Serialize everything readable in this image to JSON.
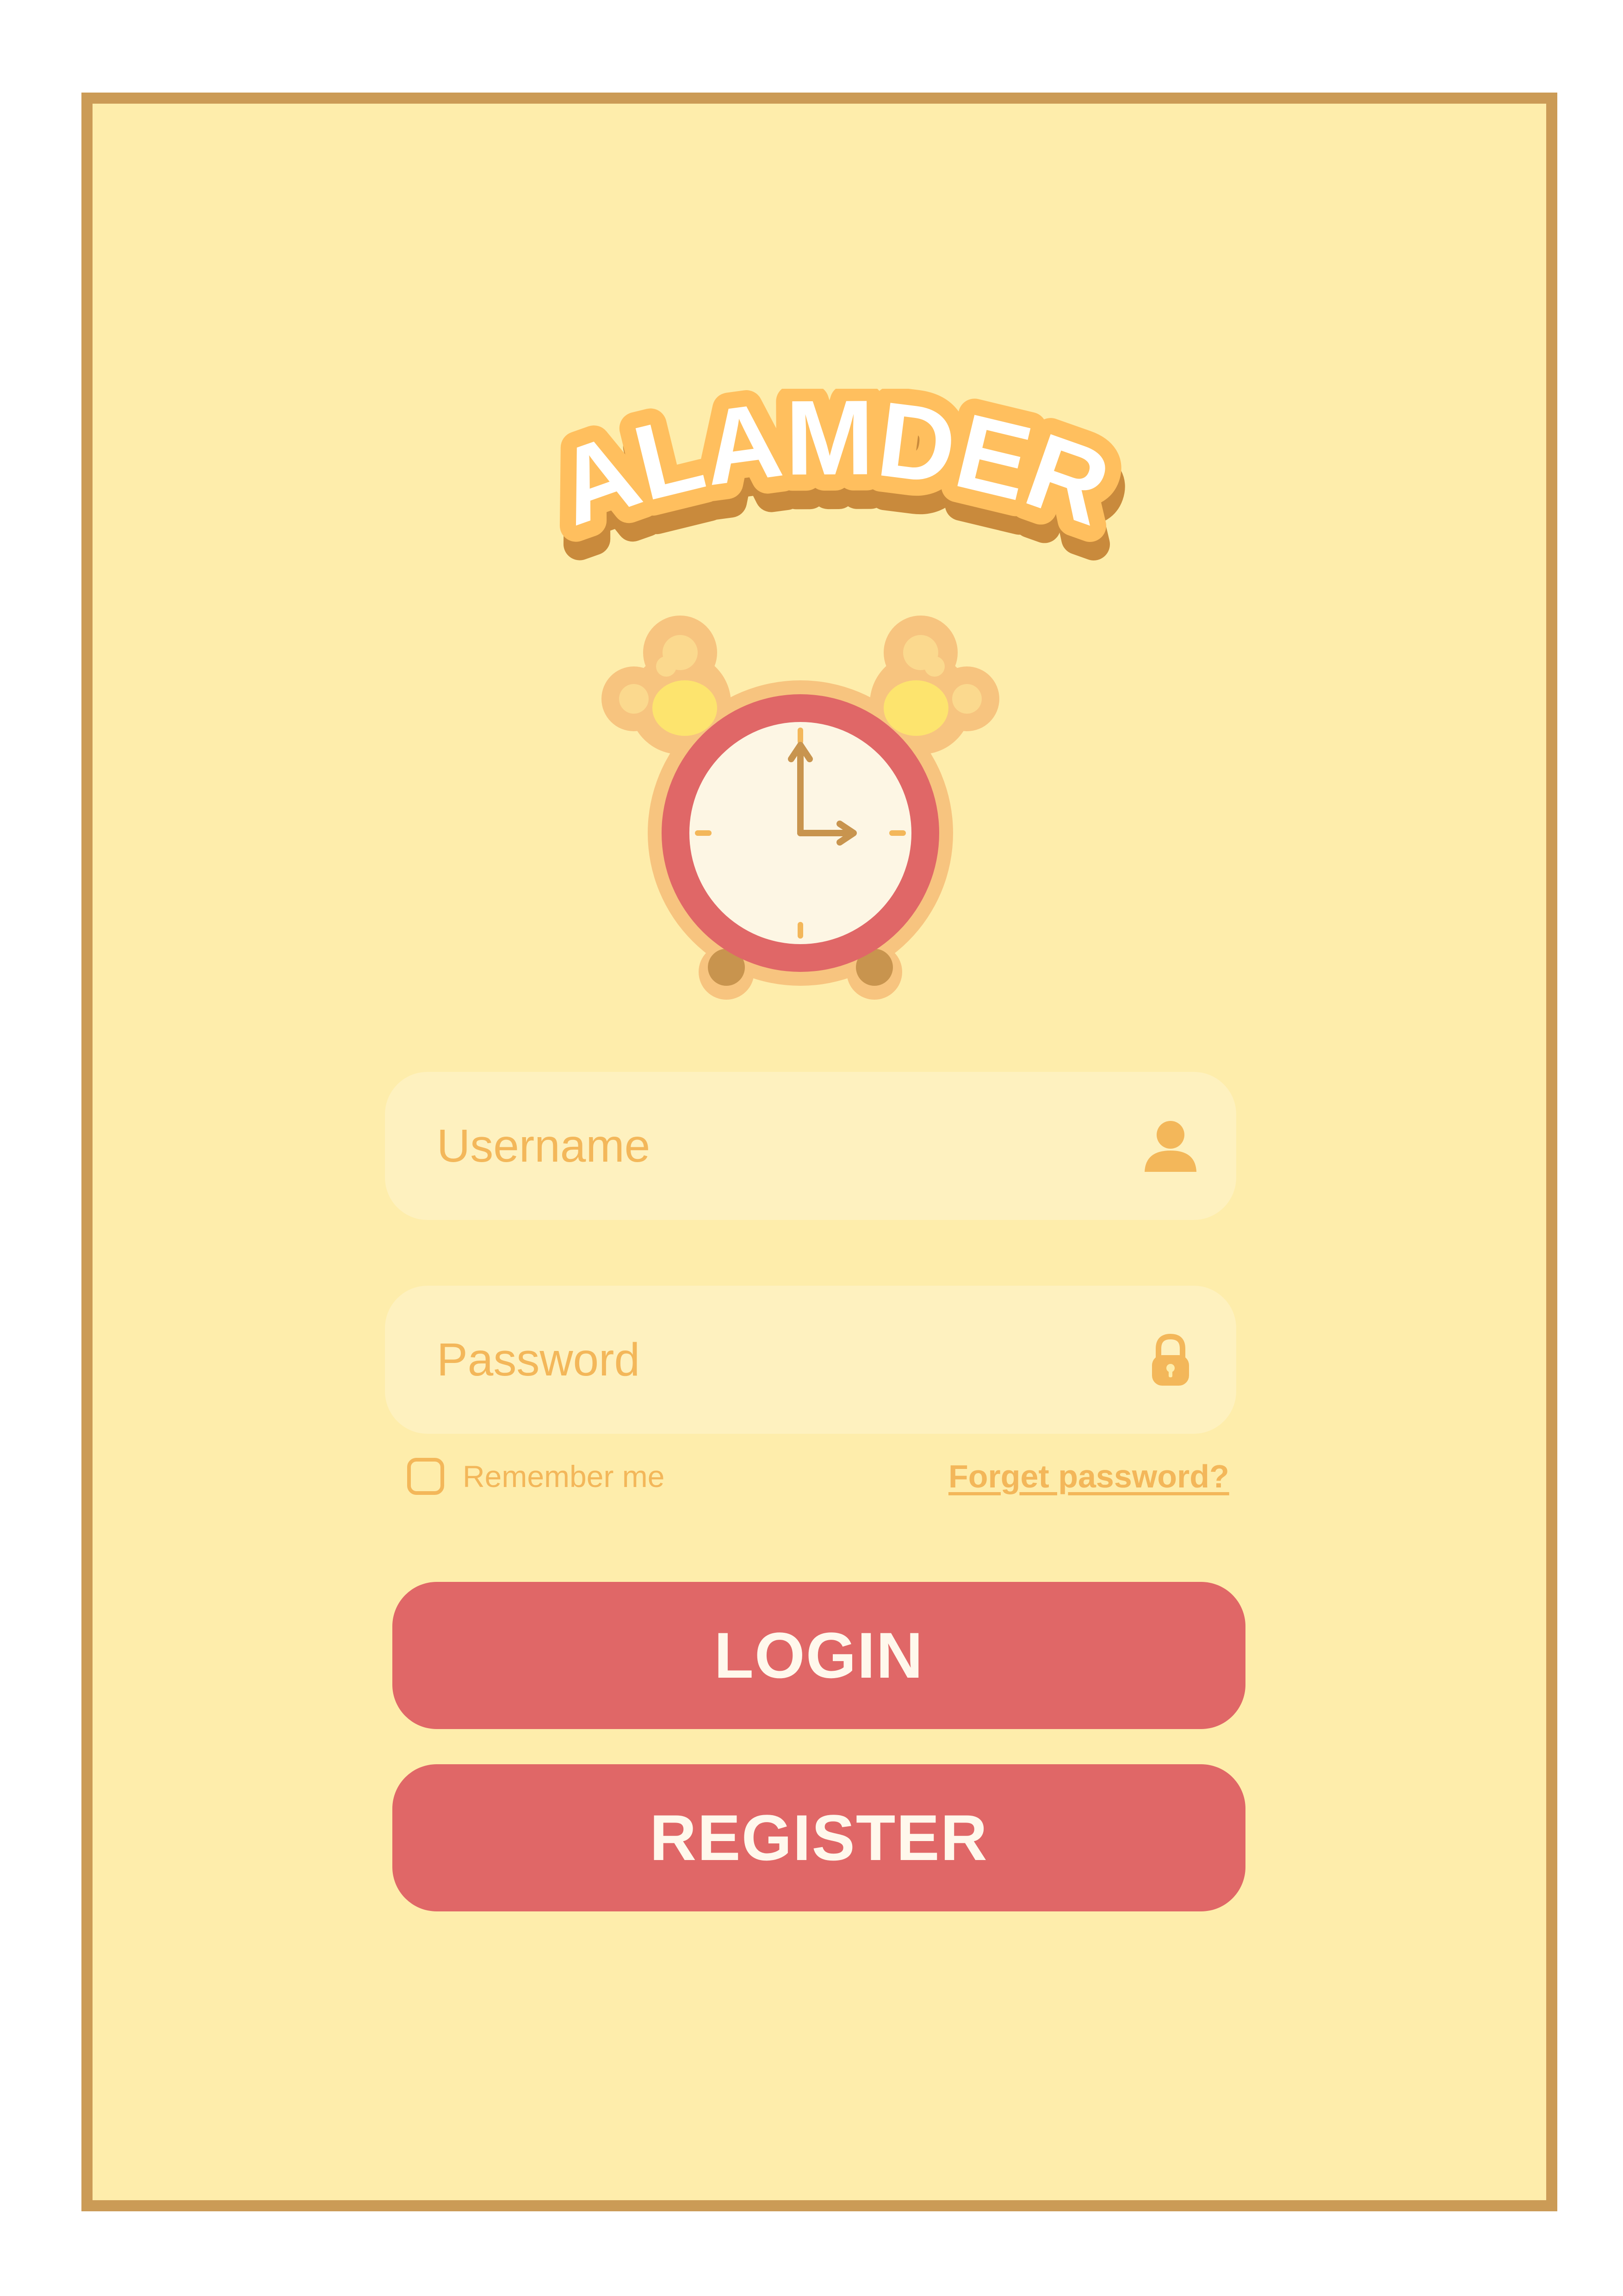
{
  "app": {
    "logo_text": "ALAMDER"
  },
  "form": {
    "username_placeholder": "Username",
    "password_placeholder": "Password",
    "remember_label": "Remember  me",
    "remember_checked": false,
    "forgot_label": "Forget password?"
  },
  "buttons": {
    "login_label": "LOGIN",
    "register_label": "REGISTER"
  },
  "icons": {
    "username": "user-icon",
    "password": "lock-icon",
    "illustration": "alarm-clock-icon"
  },
  "colors": {
    "background": "#feedab",
    "frame_border": "#cb9b56",
    "accent": "#f3b75a",
    "button": "#e06767",
    "button_text": "#fff8ec"
  }
}
